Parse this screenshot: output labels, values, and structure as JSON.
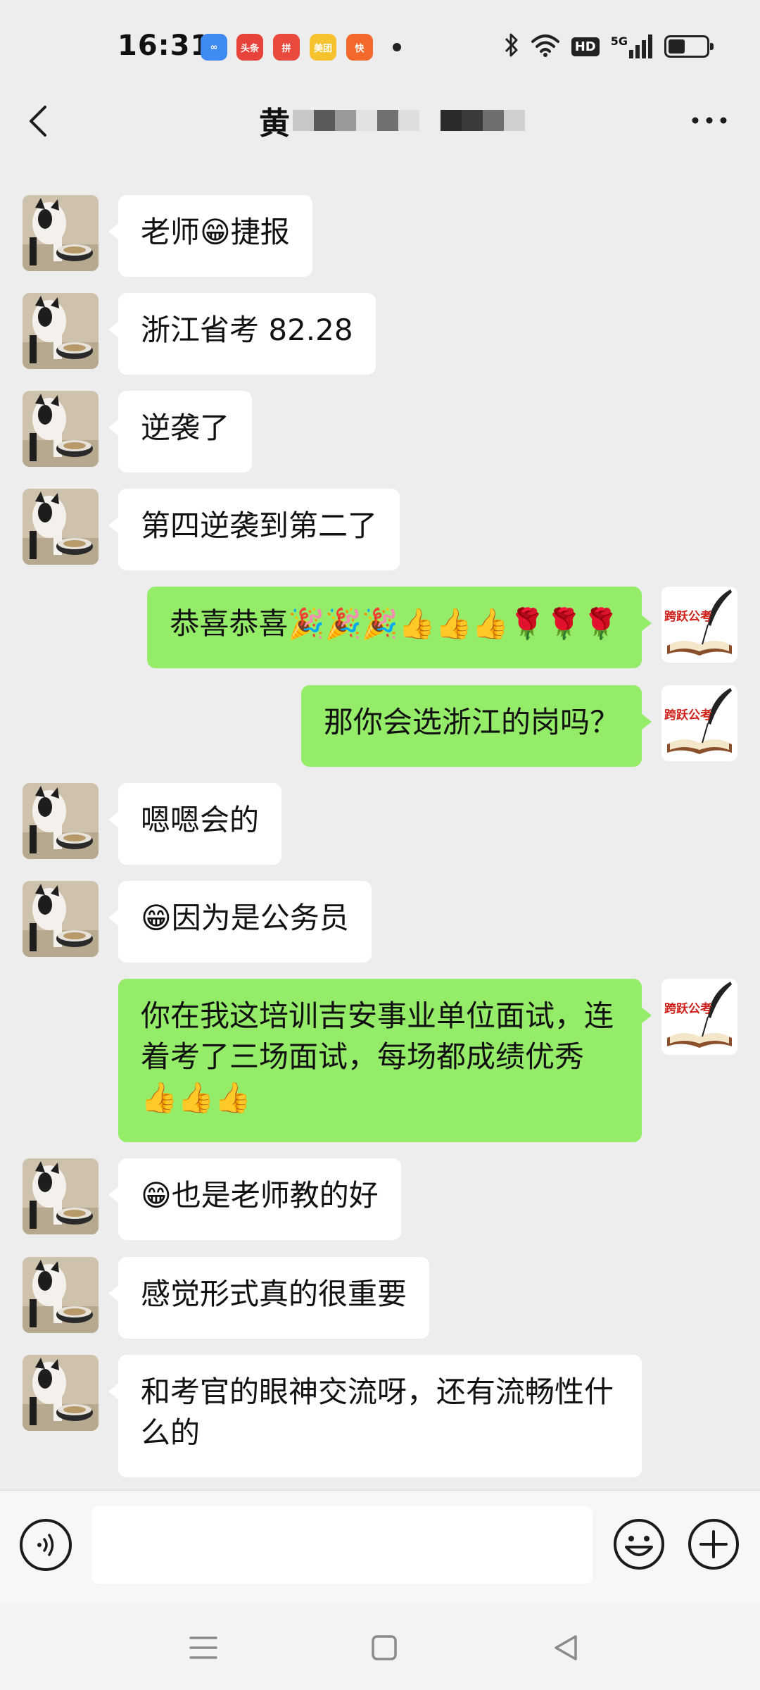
{
  "status_bar": {
    "time": "16:31",
    "app_icons": [
      {
        "name": "infinity-app-icon",
        "label": "∞",
        "color": "#3f8bf1"
      },
      {
        "name": "toutiao-app-icon",
        "label": "头条",
        "color": "#e8433a"
      },
      {
        "name": "pinduoduo-app-icon",
        "label": "拼",
        "color": "#ea4a3d"
      },
      {
        "name": "meituan-app-icon",
        "label": "美团",
        "color": "#f6c22e"
      },
      {
        "name": "kuaishou-app-icon",
        "label": "快",
        "color": "#f3692c"
      }
    ],
    "hd": "HD",
    "signal": "5G",
    "battery_level": 0.45
  },
  "header": {
    "title": "黄"
  },
  "messages": [
    {
      "side": "left",
      "text": "老师😁捷报"
    },
    {
      "side": "left",
      "text": "浙江省考 82.28"
    },
    {
      "side": "left",
      "text": "逆袭了"
    },
    {
      "side": "left",
      "text": "第四逆袭到第二了"
    },
    {
      "side": "right",
      "text": "恭喜恭喜🎉🎉🎉👍👍👍🌹🌹🌹"
    },
    {
      "side": "right",
      "text": "那你会选浙江的岗吗？"
    },
    {
      "side": "left",
      "text": "嗯嗯会的"
    },
    {
      "side": "left",
      "text": "😁因为是公务员"
    },
    {
      "side": "right",
      "text": "你在我这培训吉安事业单位面试，连着考了三场面试，每场都成绩优秀👍👍👍"
    },
    {
      "side": "left",
      "text": "😁也是老师教的好"
    },
    {
      "side": "left",
      "text": "感觉形式真的很重要"
    },
    {
      "side": "left",
      "text": "和考官的眼神交流呀，还有流畅性什么的"
    }
  ],
  "teacher_avatar": {
    "logo_text": "跨跃公考"
  },
  "input_bar": {
    "placeholder": ""
  },
  "colors": {
    "background": "#ededed",
    "bubble_self": "#95ec69",
    "bubble_other": "#ffffff"
  }
}
